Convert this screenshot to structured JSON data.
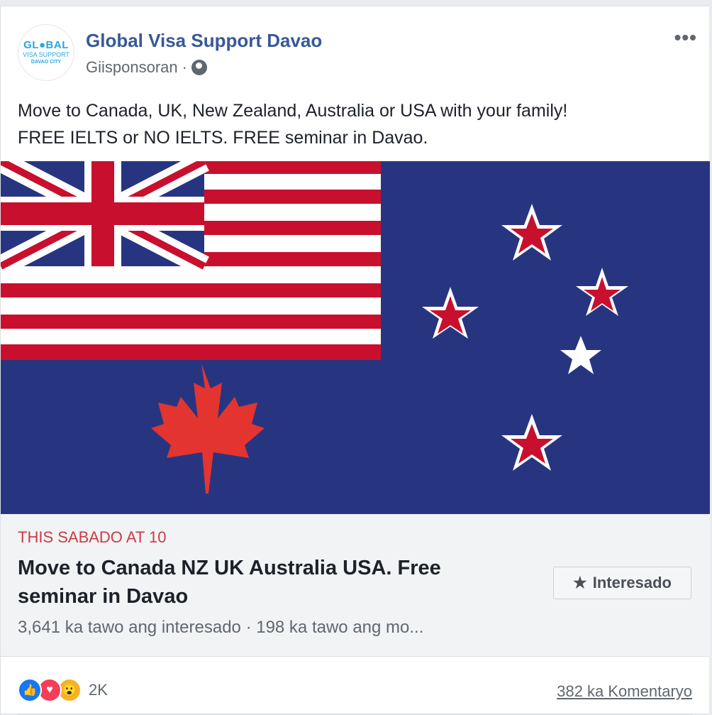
{
  "post": {
    "page_name": "Global Visa Support Davao",
    "sponsored_label": "Giisponsoran",
    "separator": "·",
    "more_label": "•••",
    "text_line1": "Move to Canada, UK, New Zealand, Australia or USA with your family!",
    "text_line2": "FREE IELTS or NO IELTS. FREE seminar in Davao."
  },
  "avatar": {
    "line1": "GL●BAL",
    "line2": "VISA SUPPORT",
    "line3": "DAVAO CITY"
  },
  "event": {
    "date": "THIS SABADO AT 10",
    "title": "Move to Canada NZ UK Australia USA. Free seminar in Davao",
    "meta": "3,641 ka tawo ang interesado · 198 ka tawo ang mo...",
    "interested_label": "Interesado",
    "interested_icon": "star-icon"
  },
  "footer": {
    "reactions": [
      "like-icon",
      "love-icon",
      "wow-icon"
    ],
    "reaction_count": "2K",
    "comments": "382 ka Komentaryo"
  },
  "colors": {
    "link": "#385898",
    "flag_blue": "#273581",
    "flag_red": "#c8102e",
    "event_date": "#cc3b44"
  }
}
